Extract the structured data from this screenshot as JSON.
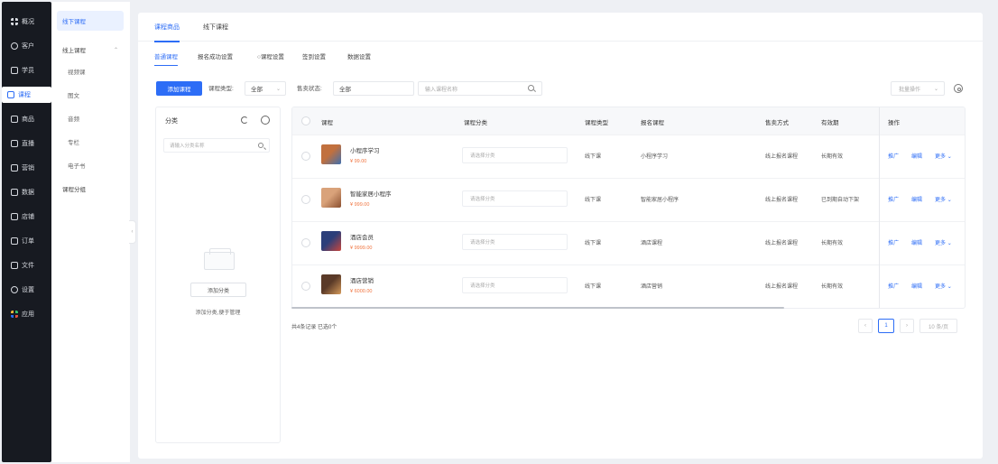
{
  "nav": {
    "items": [
      {
        "label": "概况",
        "icon": "dashboard-grid-icon"
      },
      {
        "label": "客户",
        "icon": "user-icon"
      },
      {
        "label": "学员",
        "icon": "student-icon"
      },
      {
        "label": "课程",
        "icon": "book-icon",
        "active": true
      },
      {
        "label": "商品",
        "icon": "goods-icon"
      },
      {
        "label": "直播",
        "icon": "live-icon"
      },
      {
        "label": "营销",
        "icon": "marketing-icon"
      },
      {
        "label": "数据",
        "icon": "data-icon"
      },
      {
        "label": "店铺",
        "icon": "shop-icon"
      },
      {
        "label": "订单",
        "icon": "order-icon"
      },
      {
        "label": "文件",
        "icon": "folder-icon"
      },
      {
        "label": "设置",
        "icon": "settings-icon"
      },
      {
        "label": "应用",
        "icon": "apps-icon"
      }
    ]
  },
  "subnav": {
    "items": [
      {
        "label": "线下课程",
        "active": true
      },
      {
        "label": "线上课程",
        "expandable": true
      },
      {
        "label": "视频课",
        "child": true
      },
      {
        "label": "图文",
        "child": true
      },
      {
        "label": "音频",
        "child": true
      },
      {
        "label": "专栏",
        "child": true
      },
      {
        "label": "电子书",
        "child": true
      },
      {
        "label": "课程分组"
      }
    ]
  },
  "tabs": [
    {
      "label": "课程商品",
      "active": true
    },
    {
      "label": "线下课程"
    }
  ],
  "subtabs": [
    {
      "label": "普通课程",
      "active": true
    },
    {
      "label": "报名成功设置"
    },
    {
      "label": "○课程设置"
    },
    {
      "label": "签到设置"
    },
    {
      "label": "数据设置"
    }
  ],
  "filters": {
    "add_button": "添加课程",
    "type_label": "课程类型:",
    "type_value": "全部",
    "status_label": "售卖状态:",
    "status_value": "全部",
    "search_placeholder": "输入课程名称",
    "batch_label": "批量操作"
  },
  "category": {
    "title": "分类",
    "search_placeholder": "请输入分类名称",
    "add_button": "添加分类",
    "hint": "添加分类,便于管理"
  },
  "table": {
    "headers": [
      "课程",
      "课程分类",
      "课程类型",
      "报名课程",
      "售卖方式",
      "有效期",
      "操作"
    ],
    "select_placeholder": "请选择分类",
    "rows": [
      {
        "name": "小程序学习",
        "price": "¥ 99.00",
        "type": "线下课",
        "related": "小程序学习",
        "sale": "线上报名课程",
        "validity": "长期有效",
        "thumb_colors": [
          "#c1703e",
          "#3f6fae"
        ]
      },
      {
        "name": "智能家居小程序",
        "price": "¥ 999.00",
        "type": "线下课",
        "related": "智能家居小程序",
        "sale": "线上报名课程",
        "validity": "已到期自动下架",
        "thumb_colors": [
          "#d9a27a",
          "#8a4f2f"
        ]
      },
      {
        "name": "酒店会员",
        "price": "¥ 9999.00",
        "type": "线下课",
        "related": "酒店课程",
        "sale": "线上报名课程",
        "validity": "长期有效",
        "thumb_colors": [
          "#2c3f7a",
          "#c8463d"
        ]
      },
      {
        "name": "酒店营销",
        "price": "¥ 6000.00",
        "type": "线下课",
        "related": "酒店营销",
        "sale": "线上报名课程",
        "validity": "长期有效",
        "thumb_colors": [
          "#5a3a28",
          "#d49a5a"
        ]
      }
    ],
    "ops": [
      "推广",
      "编辑",
      "更多"
    ]
  },
  "footer": {
    "total": "共4条记录 已选0个",
    "page": "1",
    "page_size": "10 条/页"
  }
}
